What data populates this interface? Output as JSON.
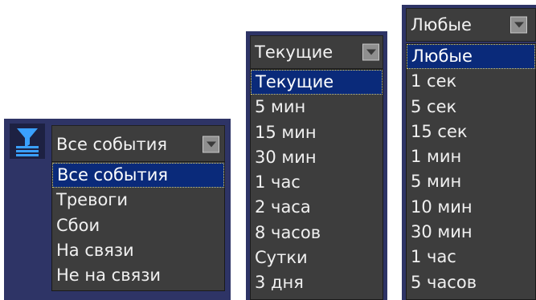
{
  "event_filter": {
    "selected": "Все события",
    "options": [
      "Все события",
      "Тревоги",
      "Сбои",
      "На связи",
      "Не на связи"
    ],
    "highlighted_index": 0
  },
  "time_filter": {
    "selected": "Текущие",
    "options": [
      "Текущие",
      "5 мин",
      "15 мин",
      "30 мин",
      "1 час",
      "2 часа",
      "8 часов",
      "Сутки",
      "3 дня"
    ],
    "highlighted_index": 0
  },
  "period_filter": {
    "selected": "Любые",
    "options": [
      "Любые",
      "1 сек",
      "5 сек",
      "15 сек",
      "1 мин",
      "5 мин",
      "10 мин",
      "30 мин",
      "1 час",
      "5 часов"
    ],
    "highlighted_index": 0
  },
  "colors": {
    "panel": "#2e3466",
    "list_bg": "#3d3d3d",
    "selection": "#0a2a7a",
    "icon": "#3aa0ff"
  },
  "icons": {
    "filter": "filter-icon",
    "dropdown": "chevron-down-icon"
  }
}
